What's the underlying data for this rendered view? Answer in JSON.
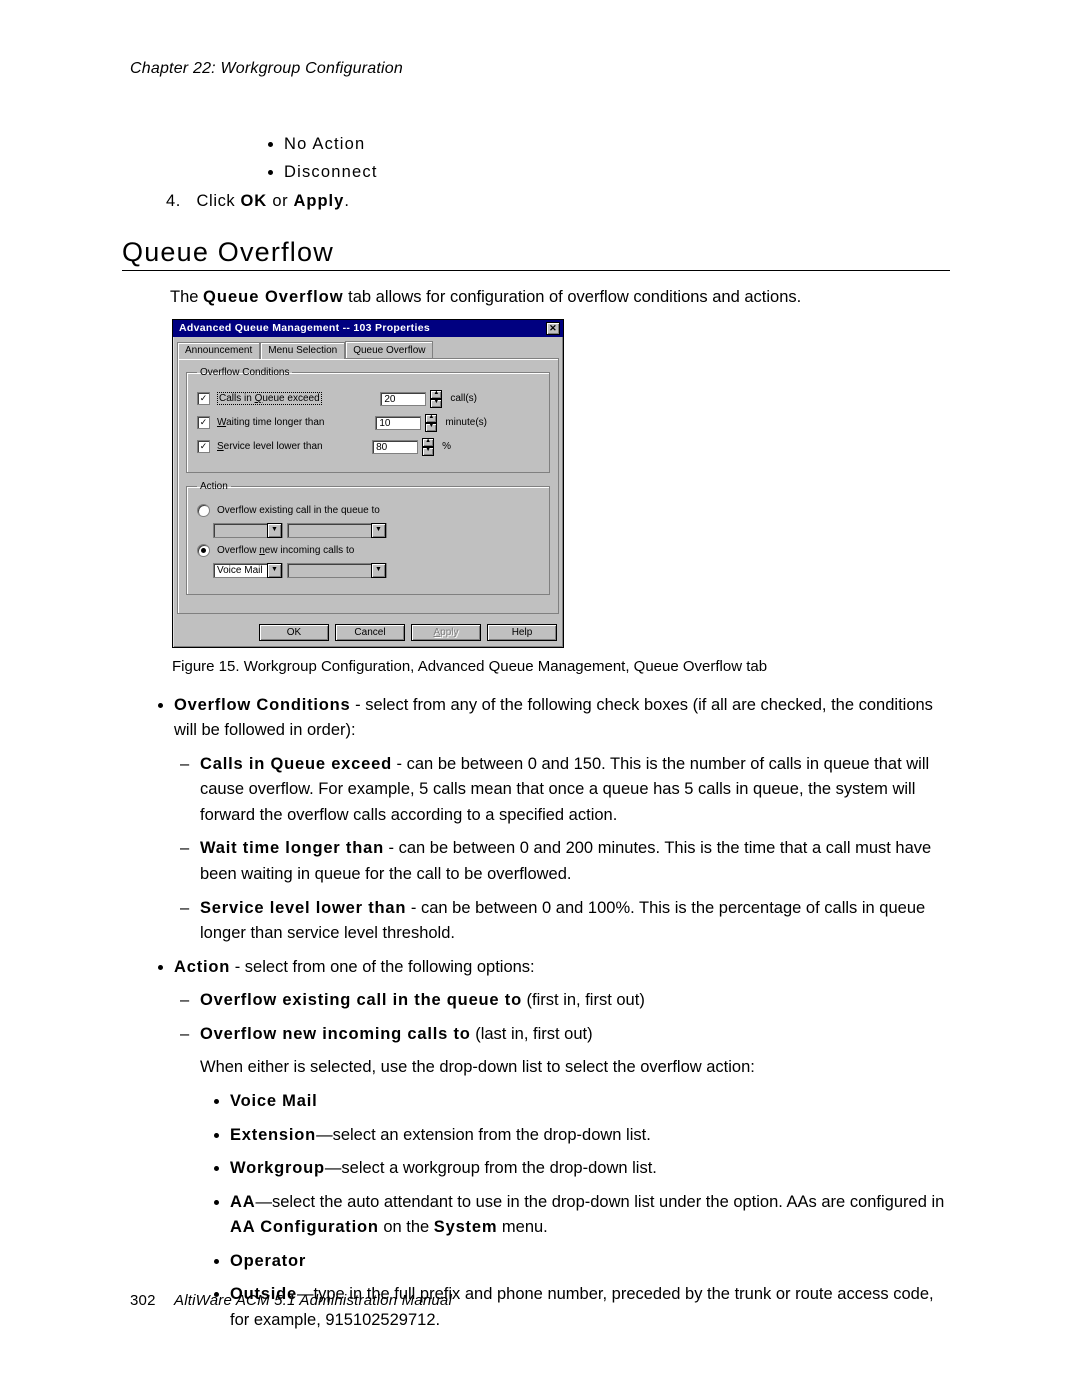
{
  "header": {
    "chapter": "Chapter 22:  Workgroup Configuration"
  },
  "top_bullets": {
    "b1": "No Action",
    "b2": "Disconnect"
  },
  "step4": {
    "num": "4.",
    "prefix": "Click ",
    "ok": "OK",
    "or": " or ",
    "apply": "Apply",
    "suffix": "."
  },
  "section_title": "Queue Overflow",
  "intro": {
    "p1a": "The ",
    "p1b": "Queue Overflow",
    "p1c": " tab allows for configuration of overflow conditions and actions."
  },
  "dialog": {
    "title": "Advanced Queue Management -- 103 Properties",
    "tabs": {
      "t1": "Announcement",
      "t2": "Menu Selection",
      "t3": "Queue Overflow"
    },
    "group_conditions": "Overflow Conditions",
    "cond1_label_a": "Calls in ",
    "cond1_accel": "Q",
    "cond1_label_b": "ueue exceed",
    "cond1_value": "20",
    "cond1_unit": "call(s)",
    "cond2_accel": "W",
    "cond2_label": "aiting time longer than",
    "cond2_value": "10",
    "cond2_unit": "minute(s)",
    "cond3_accel": "S",
    "cond3_label": "ervice level lower than",
    "cond3_value": "80",
    "cond3_unit": "%",
    "group_action": "Action",
    "radio1_label_a": "Overflow existing call in the queue to",
    "radio2_accel": "n",
    "radio2_label_a": "Overflow ",
    "radio2_label_b": "ew incoming calls to",
    "dd_value": "Voice Mail",
    "btn_ok": "OK",
    "btn_cancel": "Cancel",
    "btn_apply_accel": "A",
    "btn_apply_rest": "pply",
    "btn_help": "Help"
  },
  "figure_caption": "Figure 15.   Workgroup Configuration, Advanced Queue Management, Queue Overflow tab",
  "bul": {
    "oc_bold": "Overflow Conditions",
    "oc_rest": " - select from any of the following check boxes (if all are checked, the conditions will be followed in order):",
    "oc_d1_bold": "Calls in Queue exceed",
    "oc_d1_rest": " - can be between 0 and 150. This is the number of calls in queue that will cause overflow. For example, 5 calls mean that once a queue has 5 calls in queue, the system will forward the overflow calls according to a specified action.",
    "oc_d2_bold": "Wait time longer than",
    "oc_d2_rest": " - can be between 0 and 200 minutes. This is the time that a call must have been waiting in queue for the call to be overflowed.",
    "oc_d3_bold": "Service level lower than",
    "oc_d3_rest": " - can be between 0 and 100%. This is the percentage of calls in queue longer than service level threshold.",
    "act_bold": "Action",
    "act_rest": " - select from one of the following options:",
    "act_d1_bold": "Overflow existing call in the queue to",
    "act_d1_rest": " (first in, first out)",
    "act_d2_bold": "Overflow new incoming calls to",
    "act_d2_rest": " (last in, first out)",
    "act_body": "When either is selected, use the drop-down list to select the overflow action:",
    "opt_vm": "Voice Mail",
    "opt_ext_bold": "Extension",
    "opt_ext_rest": "—select an extension from the drop-down list.",
    "opt_wg_bold": "Workgroup",
    "opt_wg_rest": "—select a workgroup from the drop-down list.",
    "opt_aa_bold": "AA",
    "opt_aa_mid": "—select the auto attendant to use in the drop-down list under the option. AAs are configured in ",
    "opt_aa_link": "AA Configuration",
    "opt_aa_after": " on the ",
    "opt_aa_sys": "System",
    "opt_aa_end": " menu.",
    "opt_op": "Operator",
    "opt_out_bold": "Outside",
    "opt_out_rest": "—type in the full prefix and phone number, preceded by the trunk or route access code, for example, 915102529712."
  },
  "footer": {
    "page_no": "302",
    "book": "AltiWare ACM 5.1 Administration Manual"
  }
}
